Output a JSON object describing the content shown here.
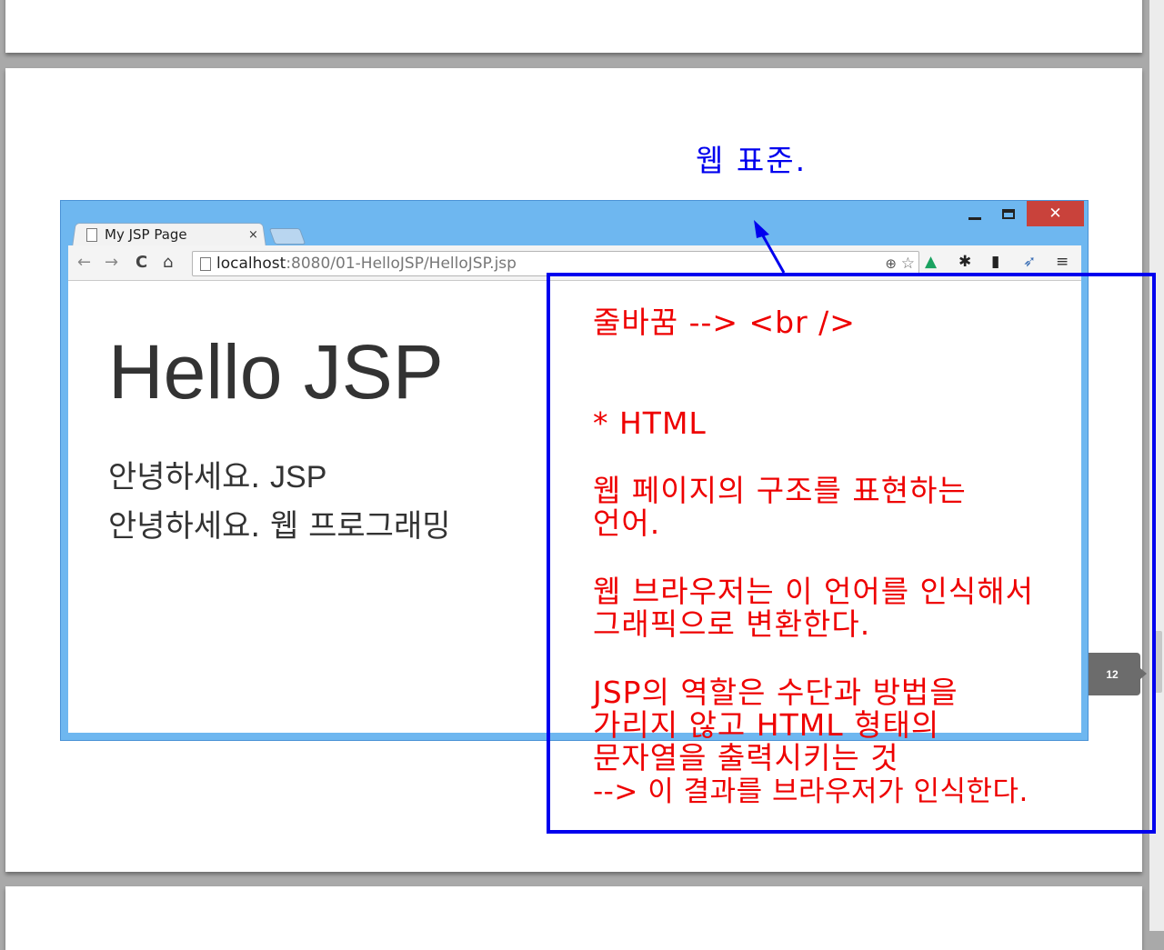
{
  "slide": {
    "caption": "웹 표준.",
    "page_number": "12"
  },
  "browser": {
    "tab_title": "My JSP Page",
    "tab_close": "×",
    "window_close": "✕",
    "url_host": "localhost",
    "url_rest": ":8080/01-HelloJSP/HelloJSP.jsp",
    "nav": {
      "back": "←",
      "forward": "→",
      "reload": "C",
      "home": "⌂"
    },
    "icons": [
      "page-icon",
      "zoom-icon",
      "star-icon",
      "drive-icon",
      "gear-icon",
      "phone-icon",
      "bird-icon",
      "menu-icon"
    ]
  },
  "content": {
    "heading": "Hello JSP",
    "line1_korean": "안녕하세요. ",
    "line1_bold": "JSP",
    "line2": "안녕하세요. 웹 프로그래밍"
  },
  "notes": {
    "line_break": "줄바꿈 --> <br />",
    "html_heading": "* HTML",
    "p1_l1": "웹 페이지의 구조를 표현하는",
    "p1_l2": "언어.",
    "p2_l1": "웹 브라우저는 이 언어를 인식해서",
    "p2_l2": "그래픽으로 변환한다.",
    "p3_l1": "JSP의 역할은 수단과 방법을",
    "p3_l2": "가리지 않고 HTML 형태의",
    "p3_l3": "문자열을 출력시키는 것",
    "p3_l4": "--> 이 결과를 브라우저가 인식한다."
  },
  "colors": {
    "annotation_blue": "#0000ee",
    "annotation_red": "#ee0000",
    "window_frame": "#6eb7f0",
    "close_button": "#c9423b"
  }
}
